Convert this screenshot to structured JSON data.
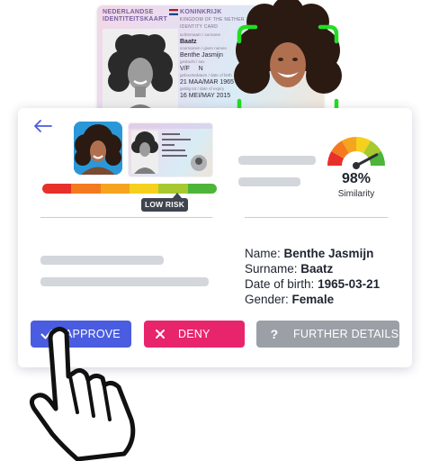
{
  "id_card": {
    "header_left_line1": "NEDERLANDSE",
    "header_left_line2": "IDENTITEITSKAART",
    "header_right_line1": "KONINKRIJK",
    "header_right_sub1": "KINGDOM OF THE NETHER",
    "header_right_sub2": "IDENTITY CARD",
    "surname_label": "achternaam / surname",
    "surname": "Baatz",
    "given_label": "voornamen / given names",
    "given_names": "Benthe Jasmijn",
    "sex_label": "geslacht / sex",
    "sex": "V/F",
    "nationality_short": "N",
    "dob_label": "geboortedatum / date of birth",
    "dob": "21 MAA/MAR 1965",
    "expiry_label": "geldig tot / date of expiry",
    "expiry": "16 MEI/MAY 2015"
  },
  "risk": {
    "label": "LOW RISK",
    "colors": [
      "#e8302a",
      "#f47a1f",
      "#f6a41f",
      "#f5d01c",
      "#a6c930",
      "#4db53a"
    ]
  },
  "similarity": {
    "value": "98%",
    "label": "Similarity",
    "percent": 98
  },
  "person": {
    "name_label": "Name:",
    "name_value": "Benthe Jasmijn",
    "surname_label": "Surname:",
    "surname_value": "Baatz",
    "dob_label": "Date of birth:",
    "dob_value": "1965-03-21",
    "gender_label": "Gender:",
    "gender_value": "Female"
  },
  "actions": {
    "approve": "APPROVE",
    "deny": "DENY",
    "further": "FURTHER DETAILS"
  },
  "colors": {
    "approve": "#4a5ce0",
    "deny": "#e8256c",
    "further": "#9ba0a7",
    "scan_frame": "#22dd22",
    "back_arrow": "#4a5ce0"
  },
  "icons": {
    "back": "arrow-left-icon",
    "approve": "check-icon",
    "deny": "close-icon",
    "further": "question-icon",
    "cursor": "hand-pointer-icon"
  }
}
